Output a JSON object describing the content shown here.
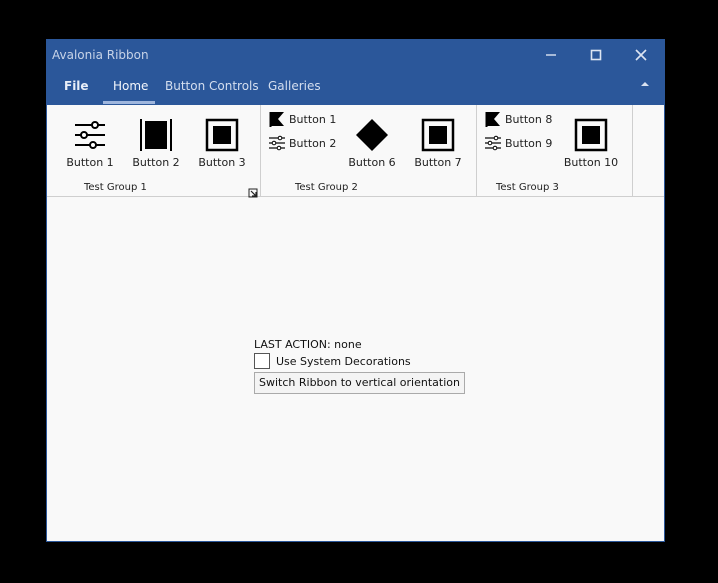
{
  "window": {
    "title": "Avalonia Ribbon"
  },
  "controls": {
    "minimize_icon": "minimize-icon",
    "maximize_icon": "maximize-icon",
    "close_icon": "close-icon"
  },
  "tabs": [
    {
      "label": "File"
    },
    {
      "label": "Home",
      "selected": true
    },
    {
      "label": "Button Controls"
    },
    {
      "label": "Galleries"
    }
  ],
  "ribbon": {
    "groups": [
      {
        "title": "Test Group 1",
        "buttons": [
          {
            "label": "Button 1",
            "icon": "sliders-icon"
          },
          {
            "label": "Button 2",
            "icon": "filled-square-bars-icon"
          },
          {
            "label": "Button 3",
            "icon": "square-in-square-icon"
          }
        ]
      },
      {
        "title": "Test Group 2",
        "buttons": [
          {
            "label": "Button 1",
            "icon": "flag-icon"
          },
          {
            "label": "Button 2",
            "icon": "sliders-icon"
          },
          {
            "label": "Button 6",
            "icon": "diamond-icon"
          },
          {
            "label": "Button 7",
            "icon": "square-in-square-icon"
          }
        ]
      },
      {
        "title": "Test Group 3",
        "buttons": [
          {
            "label": "Button 8",
            "icon": "flag-icon"
          },
          {
            "label": "Button 9",
            "icon": "sliders-icon"
          },
          {
            "label": "Button 10",
            "icon": "square-in-square-icon"
          }
        ]
      }
    ]
  },
  "content": {
    "last_action": "LAST ACTION: none",
    "system_decorations_label": "Use System Decorations",
    "system_decorations_checked": false,
    "switch_button_label": "Switch Ribbon to vertical orientation"
  }
}
